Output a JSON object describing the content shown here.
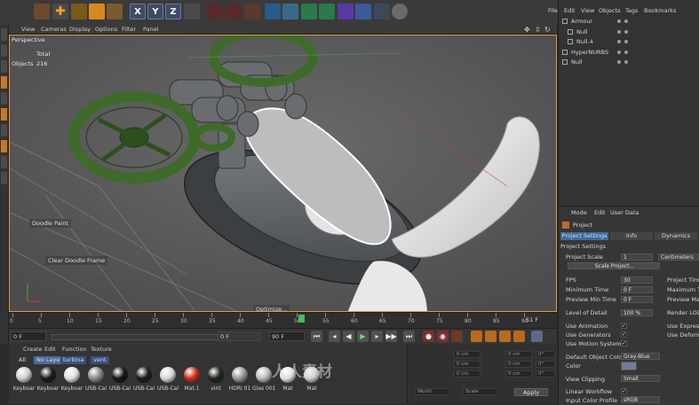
{
  "viewport": {
    "menu": [
      "View",
      "Cameras",
      "Display",
      "Options",
      "Filter",
      "Panel"
    ],
    "name": "Perspective",
    "stats_total_label": "Total",
    "stats_objects_label": "Objects",
    "stats_objects_value": "216",
    "doodle_paint": "Doodle Paint",
    "clear_doodle": "Clear Doodle Frame",
    "optimize": "Optimize..."
  },
  "toolbar": {
    "x": "X",
    "y": "Y",
    "z": "Z"
  },
  "timeline": {
    "ticks": [
      "0",
      "5",
      "10",
      "15",
      "20",
      "25",
      "30",
      "35",
      "40",
      "45",
      "50",
      "55",
      "60",
      "65",
      "70",
      "75",
      "80",
      "85",
      "90"
    ],
    "current_frame": "51 F"
  },
  "transport": {
    "start": "0 F",
    "current": "0 F",
    "end": "90 F",
    "preview_end": "90 F"
  },
  "material_manager": {
    "menu": [
      "Create",
      "Edit",
      "Function",
      "Texture"
    ],
    "filters": [
      "All",
      "No Layer",
      "turbina",
      "vent"
    ],
    "materials": [
      {
        "name": "Keyboar",
        "color": "#cfcfcf"
      },
      {
        "name": "Keyboar",
        "color": "#1a1a1a"
      },
      {
        "name": "Keyboar",
        "color": "#e0e0e0"
      },
      {
        "name": "USB-Cal",
        "color": "#8a8a8a"
      },
      {
        "name": "USB-Cal",
        "color": "#151515"
      },
      {
        "name": "USB-Cal",
        "color": "#1c1c1c"
      },
      {
        "name": "USB-Cal",
        "color": "#d8d8d8"
      },
      {
        "name": "Mat.1",
        "color": "#c8301c"
      },
      {
        "name": "vint",
        "color": "#1e2a1a"
      },
      {
        "name": "HDRI 01",
        "color": "#9a9a9a"
      },
      {
        "name": "Glas 001",
        "color": "#bcbcbc"
      },
      {
        "name": "Mat",
        "color": "#e5e5e5"
      },
      {
        "name": "Mat",
        "color": "#cdcdcd"
      }
    ]
  },
  "coordinates": {
    "fields": [
      "0 cm",
      "0 cm",
      "0 cm",
      "0 cm",
      "0 cm",
      "0 cm",
      "0°",
      "0°",
      "0°"
    ],
    "mode": "World",
    "scale_mode": "Scale",
    "apply": "Apply"
  },
  "object_manager": {
    "menu": [
      "File",
      "Edit",
      "View",
      "Objects",
      "Tags",
      "Bookmarks"
    ],
    "objects": [
      {
        "name": "Armour",
        "indent": 1
      },
      {
        "name": "Null",
        "indent": 2
      },
      {
        "name": "Null.4",
        "indent": 2
      },
      {
        "name": "HyperNURBS",
        "indent": 1
      },
      {
        "name": "Null",
        "indent": 1
      }
    ]
  },
  "attributes": {
    "menu": [
      "Mode",
      "Edit",
      "User Data"
    ],
    "title": "Project",
    "tabs": [
      "Project Settings",
      "Info",
      "Dynamics"
    ],
    "section": "Project Settings",
    "project_scale_label": "Project Scale",
    "project_scale_value": "1",
    "project_scale_unit": "Centimeters",
    "scale_project_button": "Scale Project...",
    "fps_label": "FPS",
    "fps_value": "30",
    "project_time_label": "Project Time",
    "min_time_label": "Minimum Time",
    "min_time_value": "0 F",
    "max_time_label": "Maximum Time",
    "prev_min_label": "Preview Min Time",
    "prev_min_value": "0 F",
    "prev_max_label": "Preview Max",
    "lod_label": "Level of Detail",
    "lod_value": "100 %",
    "render_lod_label": "Render LOD",
    "use_anim_label": "Use Animation",
    "use_expr_label": "Use Expressi",
    "use_gen_label": "Use Generators",
    "use_deform_label": "Use Deforme",
    "use_motion_label": "Use Motion System",
    "default_color_label": "Default Object Color",
    "default_color_value": "Gray-Blue",
    "color_label": "Color",
    "clipping_label": "View Clipping",
    "clipping_value": "Small",
    "linear_label": "Linear Workflow",
    "input_profile_label": "Input Color Profile",
    "input_profile_value": "sRGB"
  },
  "watermark": "人人素材"
}
